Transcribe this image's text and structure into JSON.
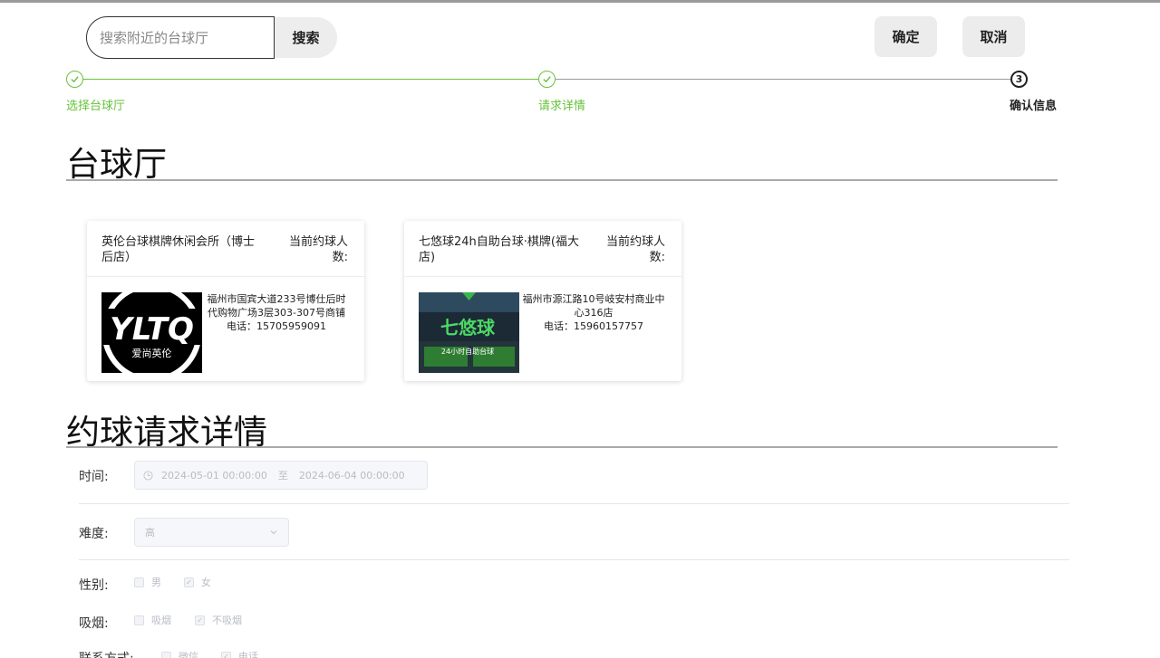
{
  "search": {
    "placeholder": "搜索附近的台球厅",
    "button_label": "搜索"
  },
  "actions": {
    "confirm_label": "确定",
    "cancel_label": "取消"
  },
  "steps": [
    {
      "label": "选择台球厅",
      "status": "done"
    },
    {
      "label": "请求详情",
      "status": "done"
    },
    {
      "label": "确认信息",
      "number": "3",
      "status": "current"
    }
  ],
  "section_halls": {
    "title": "台球厅"
  },
  "halls": [
    {
      "name": "英伦台球棋牌休闲会所（博士后店）",
      "count_label": "当前约球人数:",
      "address": "福州市国宾大道233号博仕后时代购物广场3层303-307号商铺",
      "phone": "电话：15705959091",
      "logo_text": "YLTQ",
      "logo_subtext": "爱尚英伦"
    },
    {
      "name": "七悠球24h自助台球·棋牌(福大店)",
      "count_label": "当前约球人数:",
      "address": "福州市源江路10号岐安村商业中心316店",
      "phone": "电话：15960157757",
      "logo_text": "七悠球",
      "logo_subtext": "24小时自助台球"
    }
  ],
  "section_request": {
    "title": "约球请求详情"
  },
  "form": {
    "time_label": "时间:",
    "time_start": "2024-05-01 00:00:00",
    "time_sep": "至",
    "time_end": "2024-06-04 00:00:00",
    "difficulty_label": "难度:",
    "difficulty_value": "高",
    "gender_label": "性别:",
    "gender_options": [
      {
        "label": "男",
        "checked": false
      },
      {
        "label": "女",
        "checked": true
      }
    ],
    "smoking_label": "吸烟:",
    "smoking_options": [
      {
        "label": "吸烟",
        "checked": false
      },
      {
        "label": "不吸烟",
        "checked": true
      }
    ],
    "contact_label": "联系方式:",
    "contact_options": [
      {
        "label": "微信",
        "checked": false
      },
      {
        "label": "电话",
        "checked": true
      }
    ]
  },
  "colors": {
    "accent_green": "#67c23a",
    "disabled_bg": "#f5f7fa"
  }
}
